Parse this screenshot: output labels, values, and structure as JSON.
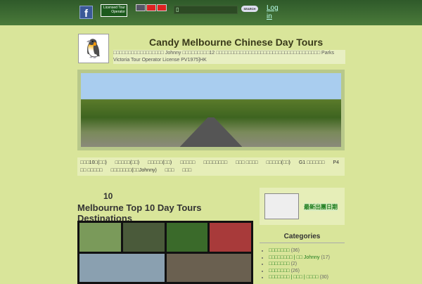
{
  "header": {
    "fb_icon": "f",
    "license_badge": "Licensed Tour Operator",
    "search_placeholder": "▯",
    "search_button": "SEARCH",
    "login": "Log in"
  },
  "site": {
    "title": "Candy Melbourne Chinese Day Tours",
    "description": "□□□□□□□□□□□□□□□□□ Johnny □□□□□□□□□12 □□□□□□□□□□□□□□□□□□□□□□□□□□□□□□□□□□□ Parks Victoria Tour Operator License PV1975]HK"
  },
  "nav": [
    "□□□10□(□□)",
    "□□□□□(□□)",
    "□□□□□(□□)",
    "□□□□□",
    "□□□□□□□□",
    "□□□ □□□□",
    "□□□□□(□□)",
    "G1 □□□□□□",
    "P4 □□ □□□□□",
    "□□□□□□□(□□Johnny)",
    "□□□",
    "□□□"
  ],
  "post": {
    "number": "10",
    "title": "Melbourne Top 10 Day Tours Destinations"
  },
  "sidebar": {
    "widget_label": "最新出團日期",
    "categories_title": "Categories",
    "categories": [
      {
        "name": "□□□□□□□",
        "count": "(36)"
      },
      {
        "name": "□□□□□□□□ | □□ Johnny",
        "count": "(17)"
      },
      {
        "name": "□□□□□□□",
        "count": "(2)"
      },
      {
        "name": "□□□□□□□",
        "count": "(26)"
      },
      {
        "name": "□□□□□□□ | □□□ | □□□□",
        "count": "(30)"
      }
    ]
  }
}
